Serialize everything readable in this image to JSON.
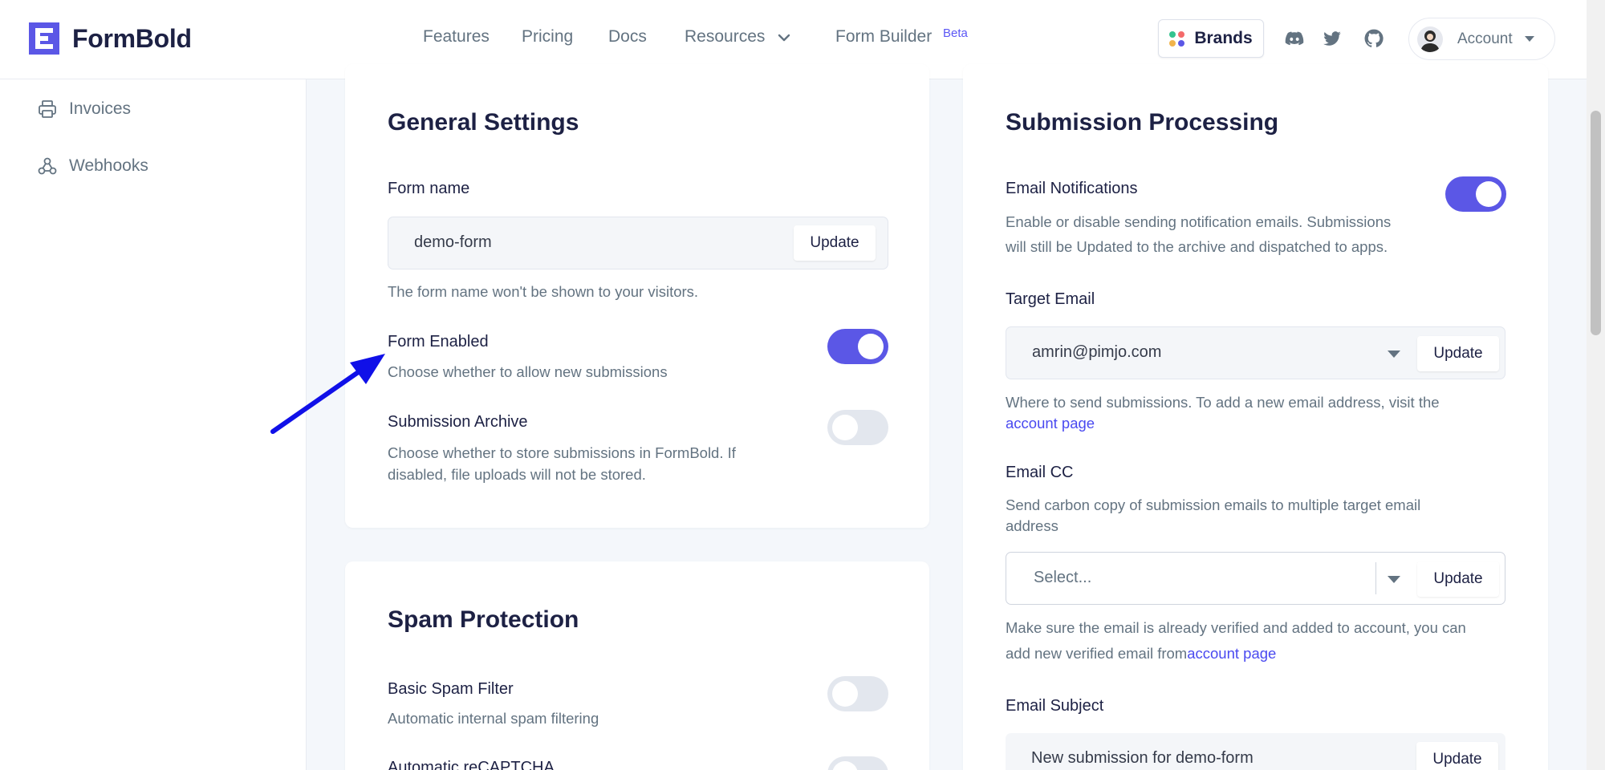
{
  "brand": {
    "name": "FormBold"
  },
  "nav": {
    "items": [
      "Features",
      "Pricing",
      "Docs",
      "Resources",
      "Form Builder"
    ],
    "beta_badge": "Beta",
    "brands_label": "Brands",
    "account_label": "Account"
  },
  "sidebar": {
    "items": [
      {
        "label": "Invoices",
        "icon": "printer-icon"
      },
      {
        "label": "Webhooks",
        "icon": "webhook-icon"
      }
    ]
  },
  "general_settings": {
    "title": "General Settings",
    "form_name_label": "Form name",
    "form_name_value": "demo-form",
    "form_name_update": "Update",
    "form_name_help": "The form name won't be shown to your visitors.",
    "form_enabled_label": "Form Enabled",
    "form_enabled_desc": "Choose whether to allow new submissions",
    "form_enabled_on": true,
    "archive_label": "Submission Archive",
    "archive_desc_line1": "Choose whether to store submissions in FormBold. If",
    "archive_desc_line2": "disabled, file uploads will not be stored.",
    "archive_on": false
  },
  "spam_protection": {
    "title": "Spam Protection",
    "basic_label": "Basic Spam Filter",
    "basic_desc": "Automatic internal spam filtering",
    "basic_on": false,
    "recaptcha_label": "Automatic reCAPTCHA",
    "recaptcha_on": false
  },
  "submission_processing": {
    "title": "Submission Processing",
    "email_notif_label": "Email Notifications",
    "email_notif_desc_line1": "Enable or disable sending notification emails. Submissions",
    "email_notif_desc_line2": "will still be Updated to the archive and dispatched to apps.",
    "email_notif_on": true,
    "target_email_label": "Target Email",
    "target_email_value": "amrin@pimjo.com",
    "target_email_update": "Update",
    "target_email_help_prefix": "Where to send submissions. To add a new email address, visit the",
    "target_email_help_link": "account page",
    "email_cc_label": "Email CC",
    "email_cc_desc_line1": "Send carbon copy of submission emails to multiple target email",
    "email_cc_desc_line2": "address",
    "email_cc_placeholder": "Select...",
    "email_cc_update": "Update",
    "email_cc_help_line1": "Make sure the email is already verified and added to account, you can",
    "email_cc_help_line2_prefix": "add new verified email from",
    "email_cc_help_link": "account page",
    "email_subject_label": "Email Subject",
    "email_subject_value": "New submission for demo-form",
    "email_subject_update": "Update"
  },
  "colors": {
    "accent": "#5b57e6",
    "annotation_arrow": "#1010e8",
    "text_dark": "#1d2144",
    "text_muted": "#637381"
  }
}
